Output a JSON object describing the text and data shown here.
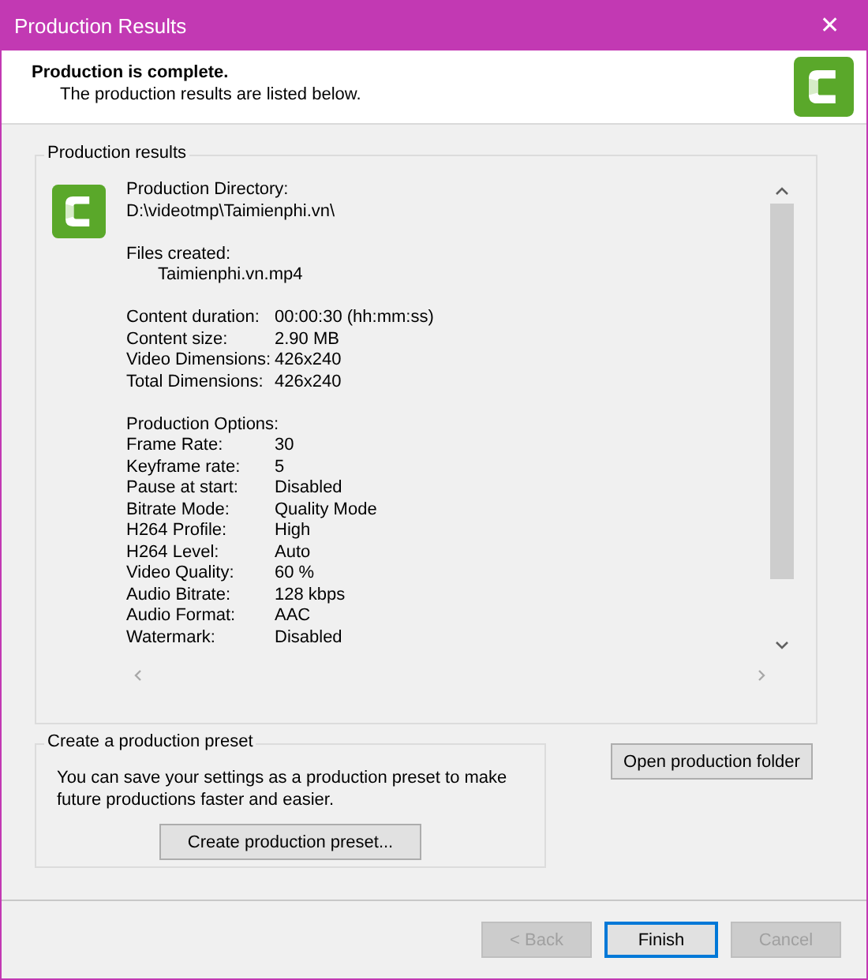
{
  "window": {
    "title": "Production Results",
    "close": "✕"
  },
  "header": {
    "title": "Production is complete.",
    "subtitle": "The production results are listed below."
  },
  "results": {
    "label": "Production results",
    "directory_label": "Production Directory:",
    "directory": "D:\\videotmp\\Taimienphi.vn\\",
    "files_label": "Files created:",
    "files": [
      "Taimienphi.vn.mp4"
    ],
    "stats": [
      {
        "label": "Content duration:",
        "value": "00:00:30 (hh:mm:ss)"
      },
      {
        "label": "Content size:",
        "value": "2.90 MB"
      },
      {
        "label": "Video Dimensions:",
        "value": "426x240"
      },
      {
        "label": "Total Dimensions:",
        "value": "426x240"
      }
    ],
    "options_label": "Production Options:",
    "options": [
      {
        "label": "Frame Rate:",
        "value": "30"
      },
      {
        "label": "Keyframe rate:",
        "value": "5"
      },
      {
        "label": "Pause at start:",
        "value": "Disabled"
      },
      {
        "label": "Bitrate Mode:",
        "value": "Quality Mode"
      },
      {
        "label": "H264 Profile:",
        "value": "High"
      },
      {
        "label": "H264 Level:",
        "value": "Auto"
      },
      {
        "label": "Video Quality:",
        "value": "60 %"
      },
      {
        "label": "Audio Bitrate:",
        "value": "128 kbps"
      },
      {
        "label": "Audio Format:",
        "value": "AAC"
      },
      {
        "label": "Watermark:",
        "value": "Disabled"
      }
    ]
  },
  "preset": {
    "label": "Create a production preset",
    "text": "You can save your settings as a production preset to make future productions faster and easier.",
    "button": "Create production preset..."
  },
  "open_folder_button": "Open production folder",
  "footer_buttons": [
    {
      "label": "< Back",
      "disabled": true,
      "default": false
    },
    {
      "label": "Finish",
      "disabled": false,
      "default": true
    },
    {
      "label": "Cancel",
      "disabled": true,
      "default": false
    }
  ]
}
